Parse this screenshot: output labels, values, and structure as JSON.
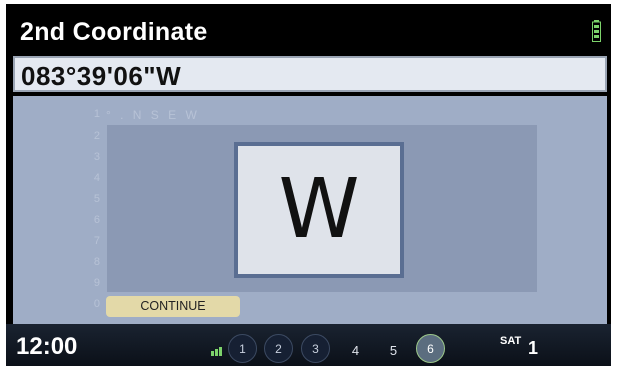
{
  "header": {
    "title": "2nd Coordinate"
  },
  "input": {
    "value": "083°39'06\"W"
  },
  "keyboard": {
    "row1": "° . N S E W",
    "row_numbers": [
      "1",
      "2",
      "3",
      "4",
      "5",
      "6",
      "7",
      "8",
      "9",
      "0"
    ],
    "selected_char": "W",
    "continue_label": "CONTINUE"
  },
  "status_bar": {
    "time": "12:00",
    "presets": [
      "1",
      "2",
      "3",
      "4",
      "5",
      "6"
    ],
    "sat_label": "SAT",
    "sat_value": "1"
  },
  "colors": {
    "accent": "#5a6e92",
    "continue_bg": "#e3d9a8",
    "panel_bg": "#9fadc6"
  }
}
